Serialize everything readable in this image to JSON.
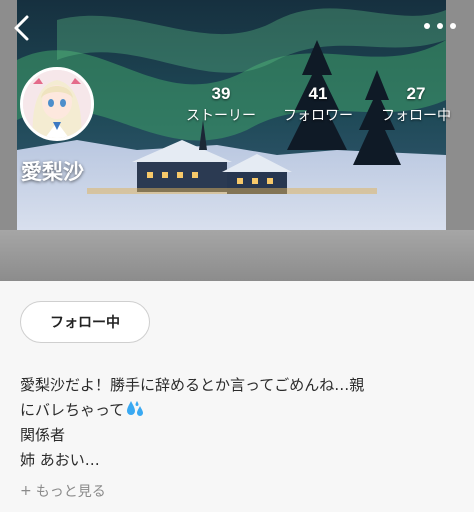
{
  "profile": {
    "username": "愛梨沙",
    "stats": [
      {
        "count": "39",
        "label": "ストーリー"
      },
      {
        "count": "41",
        "label": "フォロワー"
      },
      {
        "count": "27",
        "label": "フォロー中"
      }
    ],
    "follow_button_label": "フォロー中",
    "bio_lines": [
      "愛梨沙だよ！勝手に辞めるとか言ってごめんね…親",
      "にバレちゃって",
      "関係者",
      "姉 あおい…"
    ],
    "more_label": "もっと見る",
    "more_prefix": "+"
  },
  "icons": {
    "back": "chevron-left-icon",
    "more": "more-dots-icon",
    "sweat": "sweat-drops-emoji"
  },
  "colors": {
    "background": "#f7f7f7",
    "button_border": "#cfcfcf",
    "text": "#2b2b2b",
    "muted": "#8a8a8a",
    "emoji": "#39a9f2"
  }
}
